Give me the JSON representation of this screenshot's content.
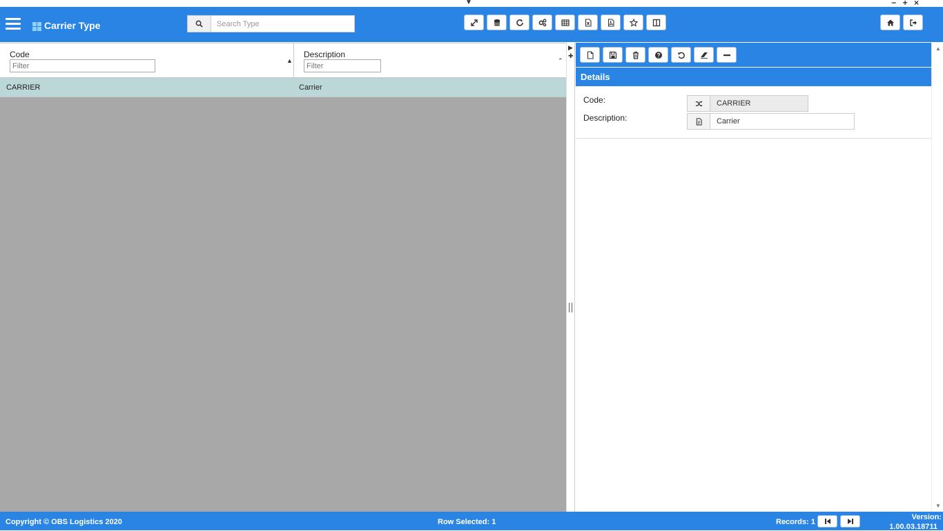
{
  "app": {
    "title": "Carrier Type"
  },
  "window": {
    "controls": "− + ×"
  },
  "search": {
    "placeholder": "Search Type"
  },
  "grid": {
    "columns": [
      {
        "label": "Code",
        "filter_placeholder": "Filter"
      },
      {
        "label": "Description",
        "filter_placeholder": "Filter"
      }
    ],
    "rows": [
      {
        "code": "CARRIER",
        "description": "Carrier"
      }
    ]
  },
  "details": {
    "title": "Details",
    "fields": [
      {
        "label": "Code:",
        "value": "CARRIER",
        "icon": "shuffle-icon"
      },
      {
        "label": "Description:",
        "value": "Carrier",
        "icon": "document-icon"
      }
    ]
  },
  "footer": {
    "copyright": "Copyright © OBS Logistics 2020",
    "row_selected": "Row Selected: 1",
    "records": "Records: 1",
    "version_label": "Version:",
    "version": "1.00.03.18711"
  },
  "colors": {
    "brand": "#2a84e4",
    "selected_row": "#bcd7d8",
    "empty_grid": "#a8a8a8"
  }
}
